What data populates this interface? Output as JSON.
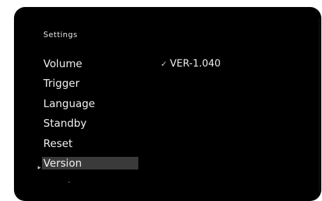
{
  "screen": {
    "title": "Settings",
    "menu": [
      {
        "label": "Volume"
      },
      {
        "label": "Trigger"
      },
      {
        "label": "Language"
      },
      {
        "label": "Standby"
      },
      {
        "label": "Reset"
      },
      {
        "label": "Version",
        "selected": true
      }
    ],
    "value_panel": {
      "check_glyph": "✓",
      "value": "VER-1.040"
    },
    "icons": {
      "selection_pointer": "triangle-right-icon",
      "more_below": "chevron-down-icon"
    },
    "colors": {
      "background": "#000000",
      "text": "#f0f0f0",
      "highlight": "#3a3a3a"
    }
  }
}
